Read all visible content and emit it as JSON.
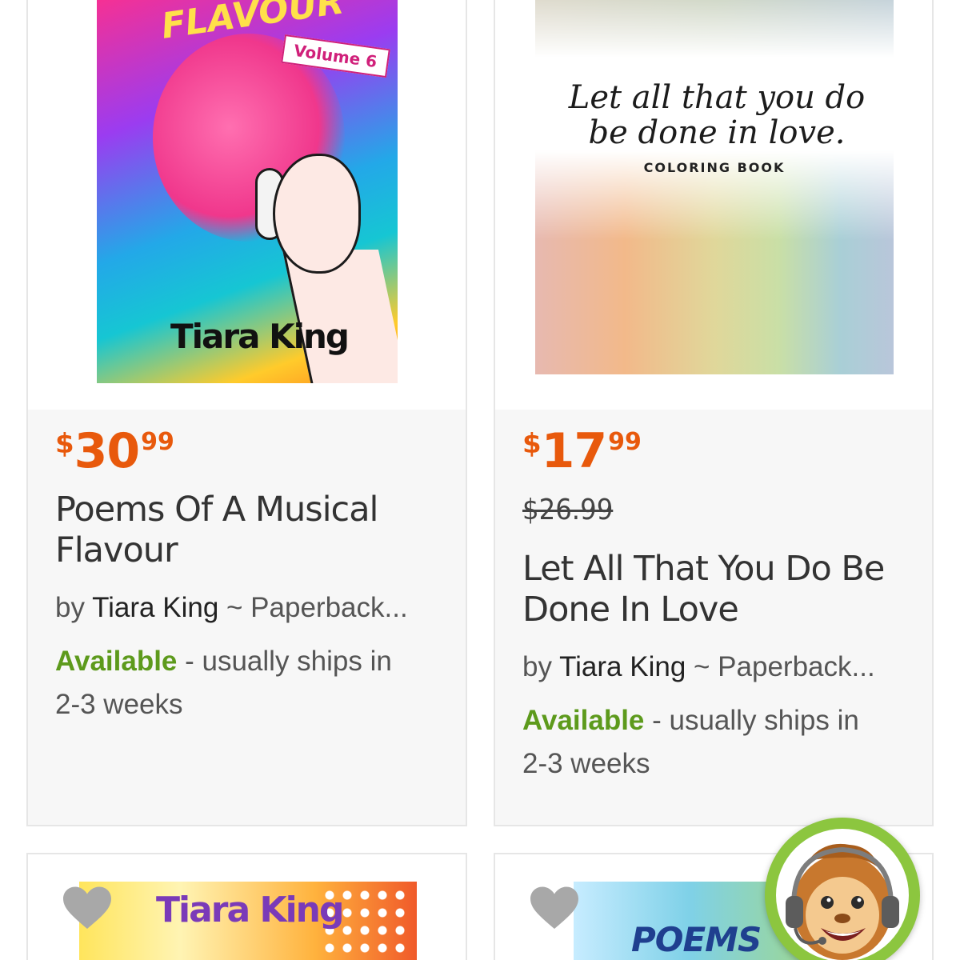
{
  "products": [
    {
      "price": {
        "currency": "$",
        "whole": "30",
        "cents": "99"
      },
      "was_price": "",
      "title_line1": "Poems Of A Musical",
      "title_line2": "Flavour",
      "by": "by ",
      "author": "Tiara King",
      "format": " ~ Paperback...",
      "availability": "Available",
      "ships_line1": " - usually ships in",
      "ships_line2": "2-3 weeks",
      "cover": {
        "title": "FLAVOUR",
        "volume": "Volume 6",
        "author": "Tiara King"
      }
    },
    {
      "price": {
        "currency": "$",
        "whole": "17",
        "cents": "99"
      },
      "was_price": "$26.99",
      "title_line1": "Let All That You Do Be",
      "title_line2": "Done In Love",
      "by": "by ",
      "author": "Tiara King",
      "format": " ~ Paperback...",
      "availability": "Available",
      "ships_line1": " - usually ships in",
      "ships_line2": "2-3 weeks",
      "cover": {
        "script_line1": "Let all that you do",
        "script_line2": "be done in love.",
        "subtitle": "COLORING BOOK"
      }
    },
    {
      "cover": {
        "title": "Tiara King"
      }
    },
    {
      "cover": {
        "title": "POEMS"
      }
    }
  ],
  "icons": {
    "favorite": "heart-icon",
    "chat": "chat-support-mascot-icon"
  },
  "colors": {
    "price": "#e8590c",
    "available": "#5d9a1c",
    "mascot_ring": "#8cc63f",
    "heart": "#a8a8a8"
  }
}
